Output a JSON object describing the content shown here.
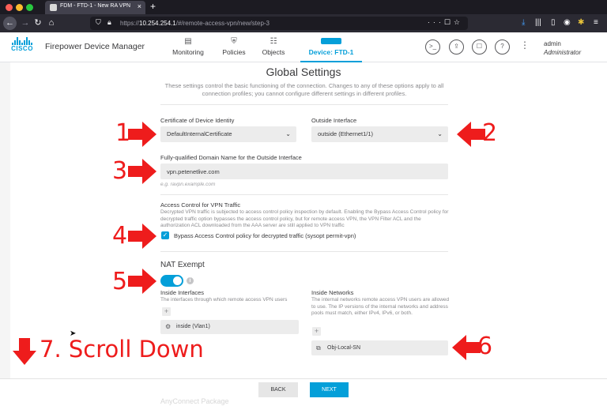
{
  "browser": {
    "tab_title": "FDM - FTD-1 - New RA VPN",
    "url_host": "10.254.254.1",
    "url_path": "/#/remote-access-vpn/new/step-3",
    "url_prefix": "https://"
  },
  "app": {
    "product_name": "Firepower Device Manager",
    "logo_text": "CISCO",
    "nav": {
      "monitoring": "Monitoring",
      "policies": "Policies",
      "objects": "Objects",
      "device": "Device: FTD-1"
    },
    "user": {
      "name": "admin",
      "role": "Administrator"
    }
  },
  "page": {
    "title": "Global Settings",
    "description": "These settings control the basic functioning of the connection. Changes to any of these options apply to all connection profiles; you cannot configure different settings in different profiles."
  },
  "form": {
    "cert_label": "Certificate of Device Identity",
    "cert_value": "DefaultInternalCertificate",
    "outside_label": "Outside Interface",
    "outside_value": "outside (Ethernet1/1)",
    "fqdn_label": "Fully-qualified Domain Name for the Outside Interface",
    "fqdn_value": "vpn.petenetlive.com",
    "fqdn_hint": "e.g. ravpn.example.com",
    "access_heading": "Access Control for VPN Traffic",
    "access_desc": "Decrypted VPN traffic is subjected to access control policy inspection by default. Enabling the Bypass Access Control policy for decrypted traffic option bypasses the access control policy, but for remote access VPN, the VPN Filter ACL and the authorization ACL downloaded from the AAA server are still applied to VPN traffic",
    "bypass_label": "Bypass Access Control policy for decrypted traffic (sysopt permit-vpn)",
    "nat_heading": "NAT Exempt",
    "nat_info": "i",
    "inside_interfaces_label": "Inside Interfaces",
    "inside_interfaces_desc": "The interfaces through which remote access VPN users",
    "inside_interface_item": "inside (Vlan1)",
    "inside_networks_label": "Inside Networks",
    "inside_networks_desc": "The internal networks remote access VPN users are allowed to use. The IP versions of the internal networks and address pools must match, either IPv4, IPv6, or both.",
    "inside_network_item": "Obj-Local-SN",
    "add_symbol": "+",
    "next_section_peek": "AnyConnect Package"
  },
  "footer": {
    "back_label": "BACK",
    "next_label": "NEXT"
  },
  "annotations": {
    "n1": "1",
    "n2": "2",
    "n3": "3",
    "n4": "4",
    "n5": "5",
    "n6": "6",
    "scroll": "7. Scroll Down"
  },
  "colors": {
    "accent": "#049fd9",
    "annotation": "#ee1c1c"
  }
}
